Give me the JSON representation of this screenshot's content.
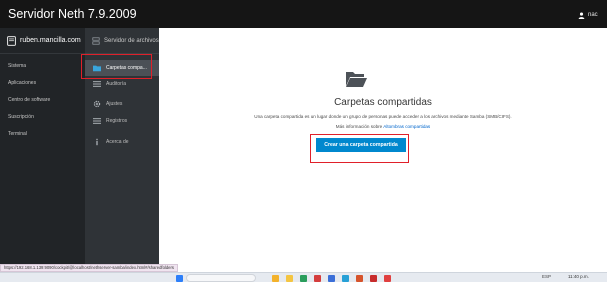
{
  "header": {
    "brand": "Servidor Neth 7.9.2009",
    "user_label": "nac"
  },
  "sidebar": {
    "hostname": "ruben.mancilla.com",
    "items": [
      {
        "label": "Sistema"
      },
      {
        "label": "Aplicaciones"
      },
      {
        "label": "Centro de software"
      },
      {
        "label": "Suscripción"
      },
      {
        "label": "Terminal"
      }
    ]
  },
  "subnav": {
    "header": "Servidor de archivos",
    "items": [
      {
        "label": "Carpetas compa...",
        "icon": "folder-icon",
        "active": true
      },
      {
        "label": "Auditoría",
        "icon": "list-icon",
        "active": false
      },
      {
        "label": "Ajustes",
        "icon": "gear-icon",
        "active": false
      },
      {
        "label": "Registros",
        "icon": "list-icon",
        "active": false
      },
      {
        "label": "Acerca de",
        "icon": "info-icon",
        "active": false
      }
    ]
  },
  "main": {
    "empty_icon": "folder-open-icon",
    "title": "Carpetas compartidas",
    "description": "Una carpeta compartida es un lugar donde un grupo de personas puede acceder a los archivos mediante Samba (SMB/CIFS).",
    "more_info_prefix": "Más información sobre",
    "more_info_link": "Altombras compartidas",
    "create_button": "Crear una carpeta compartida"
  },
  "status_bar": {
    "url": "https://192.168.1.139:9090/cockpit/@localhost/nethserver-samba/index.html#/sharedfolders"
  },
  "taskbar": {
    "language": "ESP",
    "time": "11:40 p.m."
  },
  "colors": {
    "accent": "#0088ce",
    "highlight": "#e0202a",
    "topbar": "#151515",
    "sidebar": "#212427",
    "subnav": "#2f3337"
  }
}
